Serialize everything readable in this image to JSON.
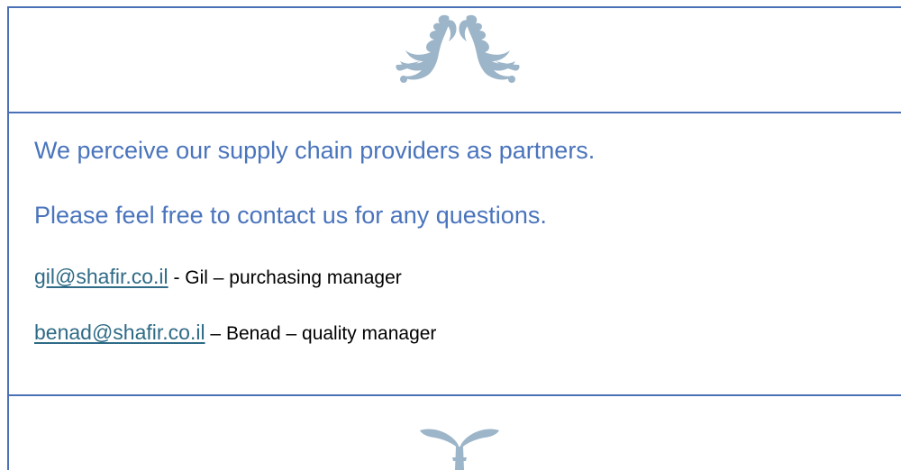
{
  "intro": {
    "line_1": "We perceive our supply chain providers as partners.",
    "line_2": "Please feel free to contact us for any questions."
  },
  "contacts": [
    {
      "email": "gil@shafir.co.il",
      "separator": " - ",
      "description": "Gil – purchasing manager"
    },
    {
      "email": "benad@shafir.co.il",
      "separator": " – ",
      "description": "Benad – quality manager"
    }
  ],
  "colors": {
    "accent_blue": "#4a74bc",
    "border_blue": "#4a71b8",
    "link_teal": "#2f6b86",
    "ornament": "#9cb5c9"
  },
  "icons": {
    "top_ornament": "floral-scroll-icon",
    "bottom_ornament": "leaf-sprout-icon"
  }
}
